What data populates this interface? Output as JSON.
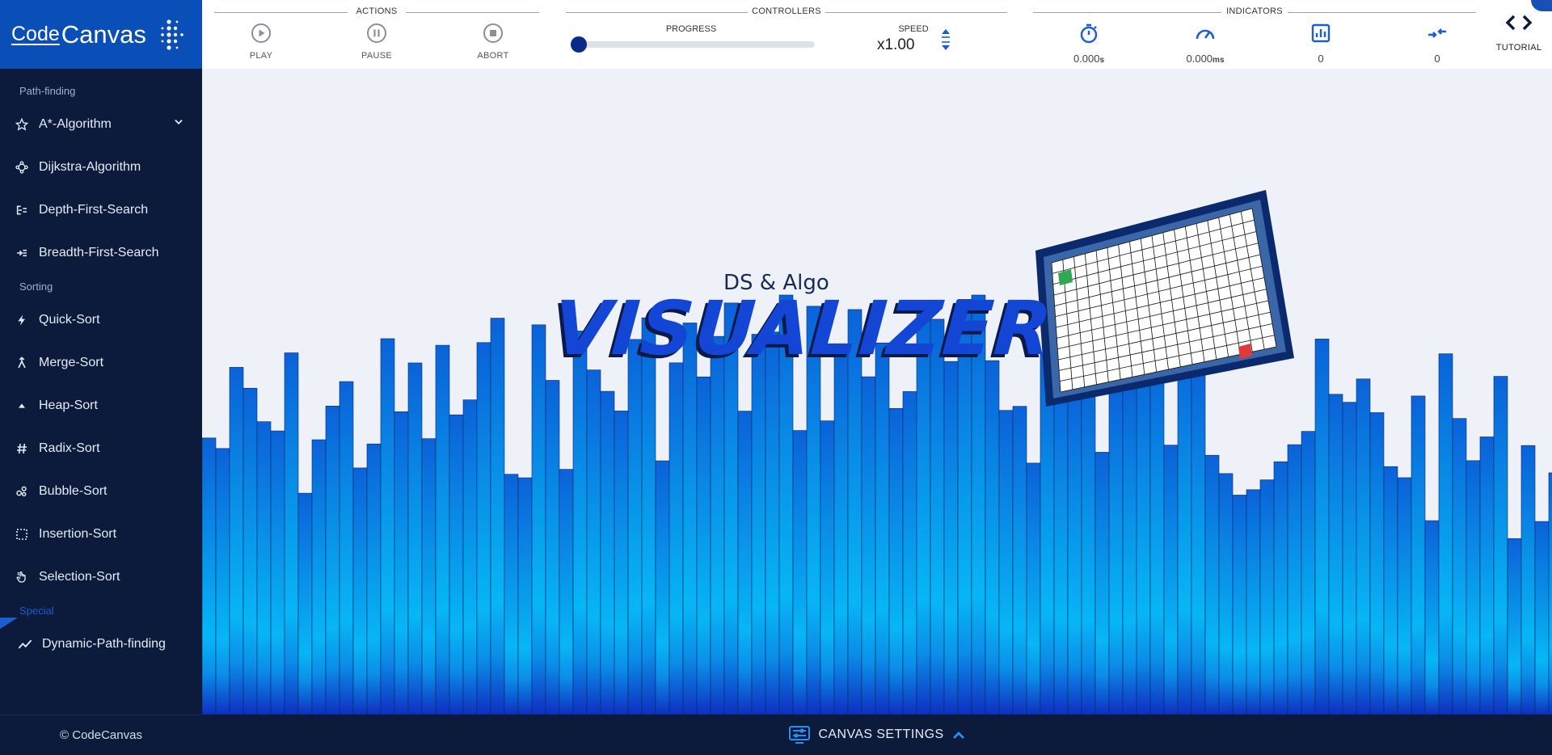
{
  "brand": {
    "code": "Code",
    "canvas": "Canvas"
  },
  "sidebar": {
    "sections": [
      {
        "label": "Path-finding"
      },
      {
        "label": "Sorting"
      },
      {
        "label": "Special"
      }
    ],
    "items": [
      {
        "label": "A*-Algorithm",
        "icon": "star-icon"
      },
      {
        "label": "Dijkstra-Algorithm",
        "icon": "nodes-icon"
      },
      {
        "label": "Depth-First-Search",
        "icon": "dfs-icon"
      },
      {
        "label": "Breadth-First-Search",
        "icon": "bfs-icon"
      },
      {
        "label": "Quick-Sort",
        "icon": "bolt-icon"
      },
      {
        "label": "Merge-Sort",
        "icon": "merge-icon"
      },
      {
        "label": "Heap-Sort",
        "icon": "triangle-icon"
      },
      {
        "label": "Radix-Sort",
        "icon": "hash-icon"
      },
      {
        "label": "Bubble-Sort",
        "icon": "bubbles-icon"
      },
      {
        "label": "Insertion-Sort",
        "icon": "dashed-square-icon"
      },
      {
        "label": "Selection-Sort",
        "icon": "pointer-icon"
      },
      {
        "label": "Dynamic-Path-finding",
        "icon": "trend-icon"
      }
    ],
    "copyright": "© CodeCanvas"
  },
  "topbar": {
    "actions": {
      "title": "ACTIONS",
      "play": "PLAY",
      "pause": "PAUSE",
      "abort": "ABORT"
    },
    "controllers": {
      "title": "CONTROLLERS",
      "progress_label": "PROGRESS",
      "progress_value": 0,
      "speed_label": "SPEED",
      "speed_value": "x1.00"
    },
    "indicators": {
      "title": "INDICATORS",
      "time_value": "0.000",
      "time_unit": "s",
      "speed_value": "0.000",
      "speed_unit": "ms",
      "count_value": "0",
      "swap_value": "0"
    },
    "tutorial": "TUTORIAL"
  },
  "hero": {
    "subtitle": "DS & Algo",
    "title": "VISUALIZER"
  },
  "bottombar": {
    "label": "CANVAS SETTINGS"
  },
  "colors": {
    "accent": "#1a5fd0",
    "sidebar": "#0c1a3c",
    "logo": "#0a4fb8",
    "start_cell": "#2fa84f",
    "end_cell": "#e23a3a"
  }
}
